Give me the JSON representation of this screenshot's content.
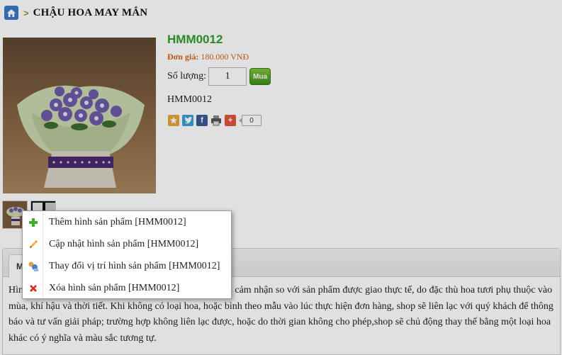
{
  "breadcrumb": {
    "home_icon": "home-icon",
    "separator": ">",
    "title": "CHẬU HOA MAY MẮN"
  },
  "product": {
    "code": "HMM0012",
    "price_label": "Đơn giá:",
    "price_value": "180.000 VNĐ",
    "qty_label": "Số lượng:",
    "qty_value": "1",
    "buy_label": "Mua",
    "code_line": "HMM0012",
    "share_count": "0",
    "share_icons": [
      "bookmark-icon",
      "twitter-icon",
      "facebook-icon",
      "print-icon",
      "addthis-plus-icon"
    ]
  },
  "tab": {
    "label": "Mô"
  },
  "description": "Hình ảnh sản phẩm có thể có sự khác biệt về màu sắc và cảm nhận so với sản phẩm được giao thực tế, do đặc thù hoa tươi phụ thuộc vào mùa, khí hậu và thời tiết. Khi không có loại hoa, hoặc bình theo mẫu vào lúc thực hiện đơn hàng, shop sẽ liên lạc với quý khách để thông báo và tư vấn giải pháp; trường hợp không liên lạc được, hoặc do thời gian không cho phép,shop sẽ chủ động thay thế bằng một loại hoa khác có ý nghĩa và màu sắc tương tự.",
  "context_menu": {
    "items": [
      {
        "label": "Thêm hình sản phẩm [HMM0012]",
        "icon": "add-icon"
      },
      {
        "label": "Cập nhật hình sản phẩm [HMM0012]",
        "icon": "pencil-icon"
      },
      {
        "label": "Thay đổi vị trí hình sản phẩm [HMM0012]",
        "icon": "reorder-icon"
      },
      {
        "label": "Xóa hình sản phẩm [HMM0012]",
        "icon": "delete-icon"
      }
    ]
  },
  "colors": {
    "code_green": "#2e9e2e",
    "price_orange": "#d4641a",
    "buy_green": "#4f9e22",
    "home_blue": "#3a78c4"
  }
}
